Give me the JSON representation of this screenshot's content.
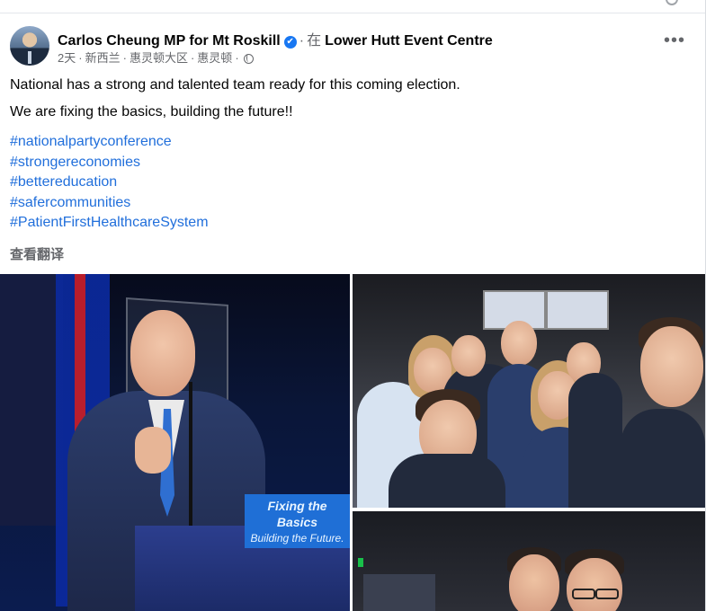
{
  "author": {
    "name": "Carlos Cheung MP for Mt Roskill",
    "verified_glyph": "✔",
    "at_word": "在",
    "location": "Lower Hutt Event Centre"
  },
  "meta": {
    "time": "2天",
    "place_parts": [
      "新西兰",
      "惠灵顿大区",
      "惠灵顿"
    ],
    "audience_icon": "globe-icon"
  },
  "more_button": "•••",
  "post": {
    "line1": "National has a strong and talented team ready for this coming election.",
    "line2": "We are fixing the basics, building the future!!",
    "hashtags": [
      "#nationalpartyconference",
      "#strongereconomies",
      "#bettereducation",
      "#safercommunities",
      "#PatientFirstHealthcareSystem"
    ],
    "translate": "查看翻译"
  },
  "photos": {
    "main_sign_line1": "Fixing the Basics",
    "main_sign_line2": "Building the Future."
  },
  "colors": {
    "link": "#216fdb",
    "secondary_text": "#65676b",
    "verified": "#1877f2"
  }
}
